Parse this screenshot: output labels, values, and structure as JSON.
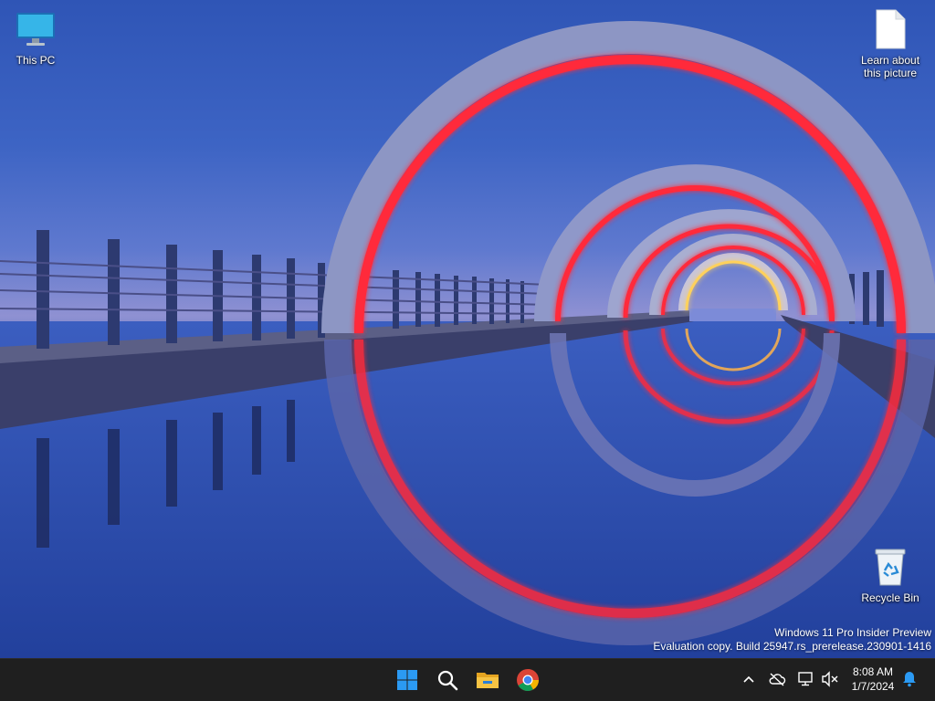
{
  "desktop": {
    "icons": [
      {
        "id": "this-pc",
        "label": "This PC",
        "icon": "monitor-icon"
      },
      {
        "id": "learn",
        "label": "Learn about\nthis picture",
        "icon": "document-icon"
      },
      {
        "id": "recycle",
        "label": "Recycle Bin",
        "icon": "recycle-bin-icon"
      }
    ]
  },
  "watermark": {
    "line1": "Windows 11 Pro Insider Preview",
    "line2": "Evaluation copy. Build 25947.rs_prerelease.230901-1416"
  },
  "taskbar": {
    "pinned": [
      {
        "id": "start",
        "icon": "windows-start-icon"
      },
      {
        "id": "search",
        "icon": "search-icon"
      },
      {
        "id": "explorer",
        "icon": "file-explorer-icon"
      },
      {
        "id": "chrome",
        "icon": "chrome-icon"
      }
    ],
    "tray": {
      "icons": [
        "chevron-up-icon",
        "cloud-offline-icon",
        "network-icon",
        "volume-muted-icon",
        "notification-bell-icon"
      ],
      "time": "8:08 AM",
      "date": "1/7/2024"
    }
  },
  "colors": {
    "taskbar_bg": "#1f1f1f",
    "wallpaper_sky": "#2f55b6",
    "wallpaper_ring_glow": "#ff2a3a",
    "windows_blue": "#2b9af3",
    "explorer_yellow": "#f6c343"
  }
}
